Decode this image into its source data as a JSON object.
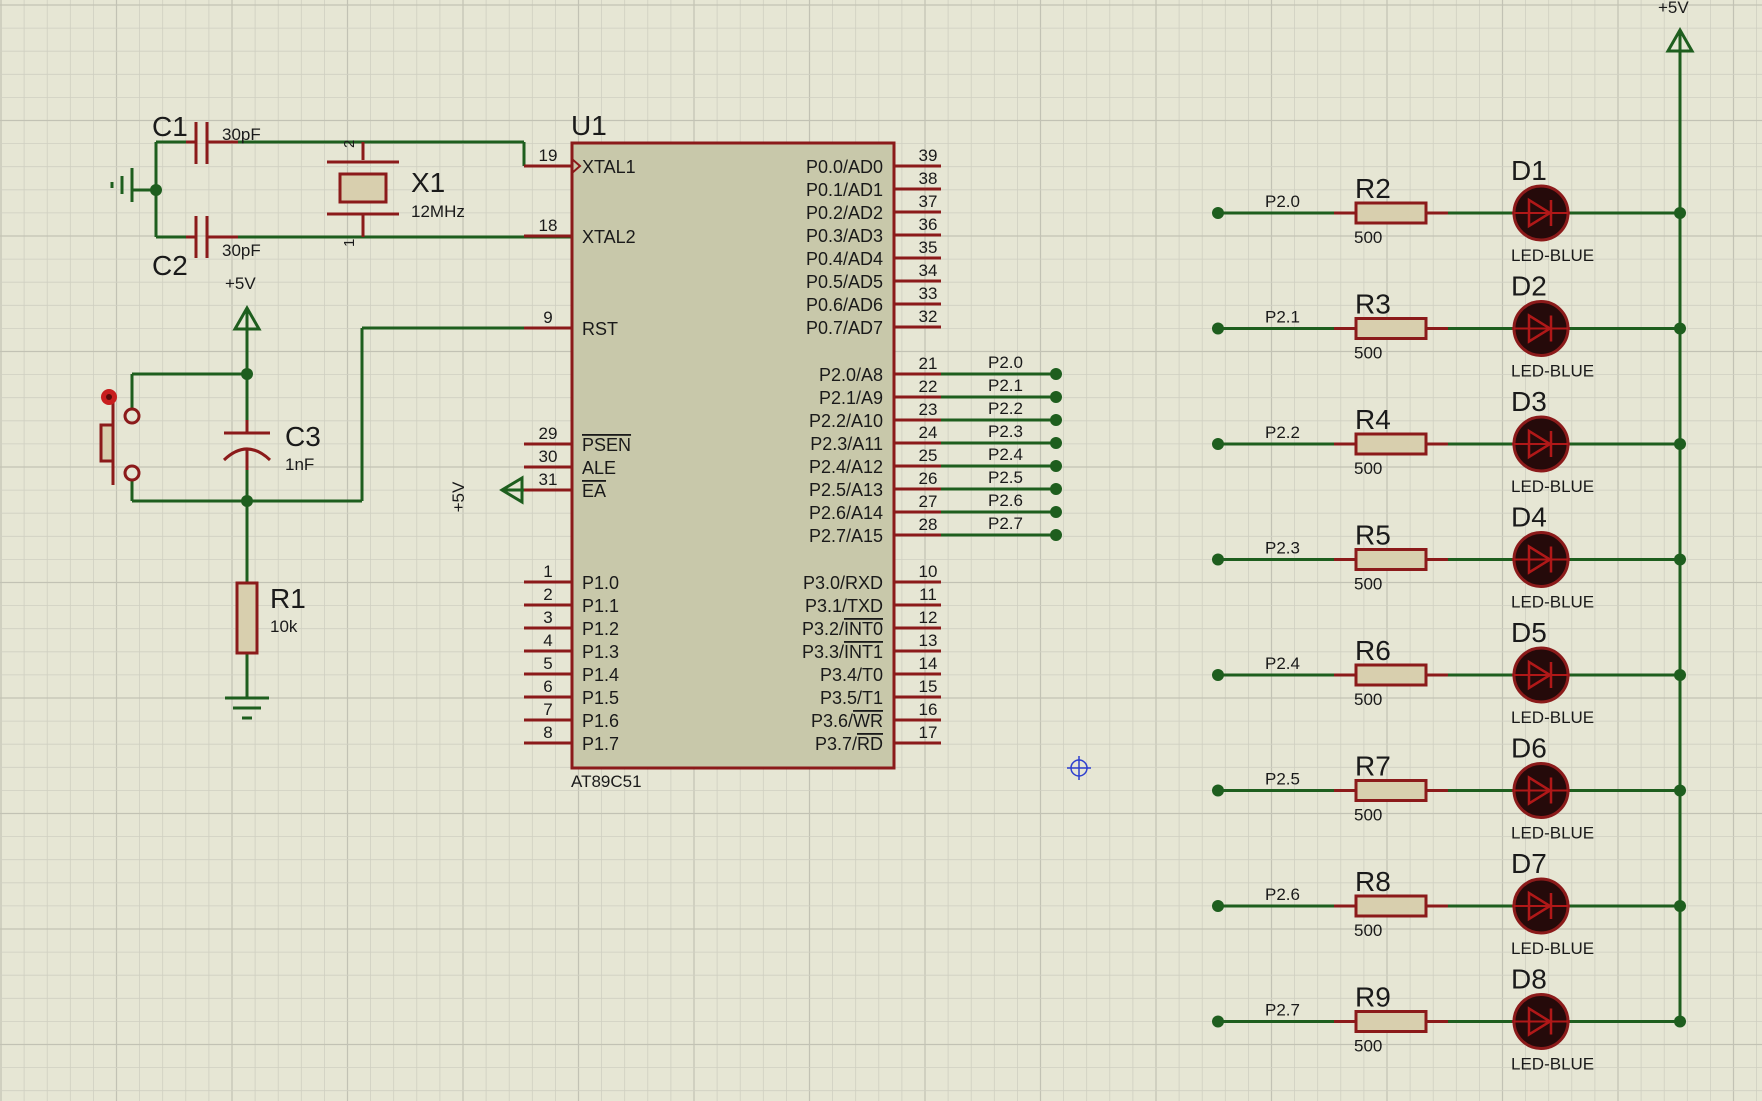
{
  "colors": {
    "background": "#e6e6d4",
    "grid_minor": "#cfcfc1",
    "grid_major": "#c2c2b4",
    "wire": "#1e5e1e",
    "component_outline": "#8b1a1a",
    "chip_fill": "#c8c8aa",
    "resistor_fill": "#d8cfae",
    "led_fill": "#250a0a",
    "text": "#1a1a1a",
    "cursor": "#2d3fcf"
  },
  "power_label": "+5V",
  "mcu": {
    "ref": "U1",
    "part": "AT89C51",
    "left_pins": [
      {
        "num": "19",
        "name": "XTAL1",
        "clock": true
      },
      {
        "num": "18",
        "name": "XTAL2"
      },
      {
        "num": "9",
        "name": "RST"
      },
      {
        "num": "29",
        "name": "PSEN",
        "overline": true
      },
      {
        "num": "30",
        "name": "ALE"
      },
      {
        "num": "31",
        "name": "EA",
        "overline": true
      },
      {
        "num": "1",
        "name": "P1.0"
      },
      {
        "num": "2",
        "name": "P1.1"
      },
      {
        "num": "3",
        "name": "P1.2"
      },
      {
        "num": "4",
        "name": "P1.3"
      },
      {
        "num": "5",
        "name": "P1.4"
      },
      {
        "num": "6",
        "name": "P1.5"
      },
      {
        "num": "7",
        "name": "P1.6"
      },
      {
        "num": "8",
        "name": "P1.7"
      }
    ],
    "right_pins": [
      {
        "num": "39",
        "name": "P0.0/AD0"
      },
      {
        "num": "38",
        "name": "P0.1/AD1"
      },
      {
        "num": "37",
        "name": "P0.2/AD2"
      },
      {
        "num": "36",
        "name": "P0.3/AD3"
      },
      {
        "num": "35",
        "name": "P0.4/AD4"
      },
      {
        "num": "34",
        "name": "P0.5/AD5"
      },
      {
        "num": "33",
        "name": "P0.6/AD6"
      },
      {
        "num": "32",
        "name": "P0.7/AD7"
      },
      {
        "num": "21",
        "name": "P2.0/A8",
        "net": "P2.0"
      },
      {
        "num": "22",
        "name": "P2.1/A9",
        "net": "P2.1"
      },
      {
        "num": "23",
        "name": "P2.2/A10",
        "net": "P2.2"
      },
      {
        "num": "24",
        "name": "P2.3/A11",
        "net": "P2.3"
      },
      {
        "num": "25",
        "name": "P2.4/A12",
        "net": "P2.4"
      },
      {
        "num": "26",
        "name": "P2.5/A13",
        "net": "P2.5"
      },
      {
        "num": "27",
        "name": "P2.6/A14",
        "net": "P2.6"
      },
      {
        "num": "28",
        "name": "P2.7/A15",
        "net": "P2.7"
      },
      {
        "num": "10",
        "name": "P3.0/RXD"
      },
      {
        "num": "11",
        "name": "P3.1/TXD"
      },
      {
        "num": "12",
        "name": "P3.2/",
        "over": "INT0"
      },
      {
        "num": "13",
        "name": "P3.3/",
        "over": "INT1"
      },
      {
        "num": "14",
        "name": "P3.4/T0"
      },
      {
        "num": "15",
        "name": "P3.5/T1"
      },
      {
        "num": "16",
        "name": "P3.6/",
        "over": "WR"
      },
      {
        "num": "17",
        "name": "P3.7/",
        "over": "RD"
      }
    ]
  },
  "oscillator": {
    "c1": {
      "ref": "C1",
      "value": "30pF"
    },
    "c2": {
      "ref": "C2",
      "value": "30pF"
    },
    "crystal": {
      "ref": "X1",
      "value": "12MHz",
      "pin_top": "2",
      "pin_bottom": "1"
    }
  },
  "reset": {
    "c3": {
      "ref": "C3",
      "value": "1nF"
    },
    "r1": {
      "ref": "R1",
      "value": "10k"
    }
  },
  "led_rows": [
    {
      "net": "P2.0",
      "resistor": "R2",
      "value": "500",
      "led": "D1",
      "led_type": "LED-BLUE"
    },
    {
      "net": "P2.1",
      "resistor": "R3",
      "value": "500",
      "led": "D2",
      "led_type": "LED-BLUE"
    },
    {
      "net": "P2.2",
      "resistor": "R4",
      "value": "500",
      "led": "D3",
      "led_type": "LED-BLUE"
    },
    {
      "net": "P2.3",
      "resistor": "R5",
      "value": "500",
      "led": "D4",
      "led_type": "LED-BLUE"
    },
    {
      "net": "P2.4",
      "resistor": "R6",
      "value": "500",
      "led": "D5",
      "led_type": "LED-BLUE"
    },
    {
      "net": "P2.5",
      "resistor": "R7",
      "value": "500",
      "led": "D6",
      "led_type": "LED-BLUE"
    },
    {
      "net": "P2.6",
      "resistor": "R8",
      "value": "500",
      "led": "D7",
      "led_type": "LED-BLUE"
    },
    {
      "net": "P2.7",
      "resistor": "R9",
      "value": "500",
      "led": "D8",
      "led_type": "LED-BLUE"
    }
  ]
}
